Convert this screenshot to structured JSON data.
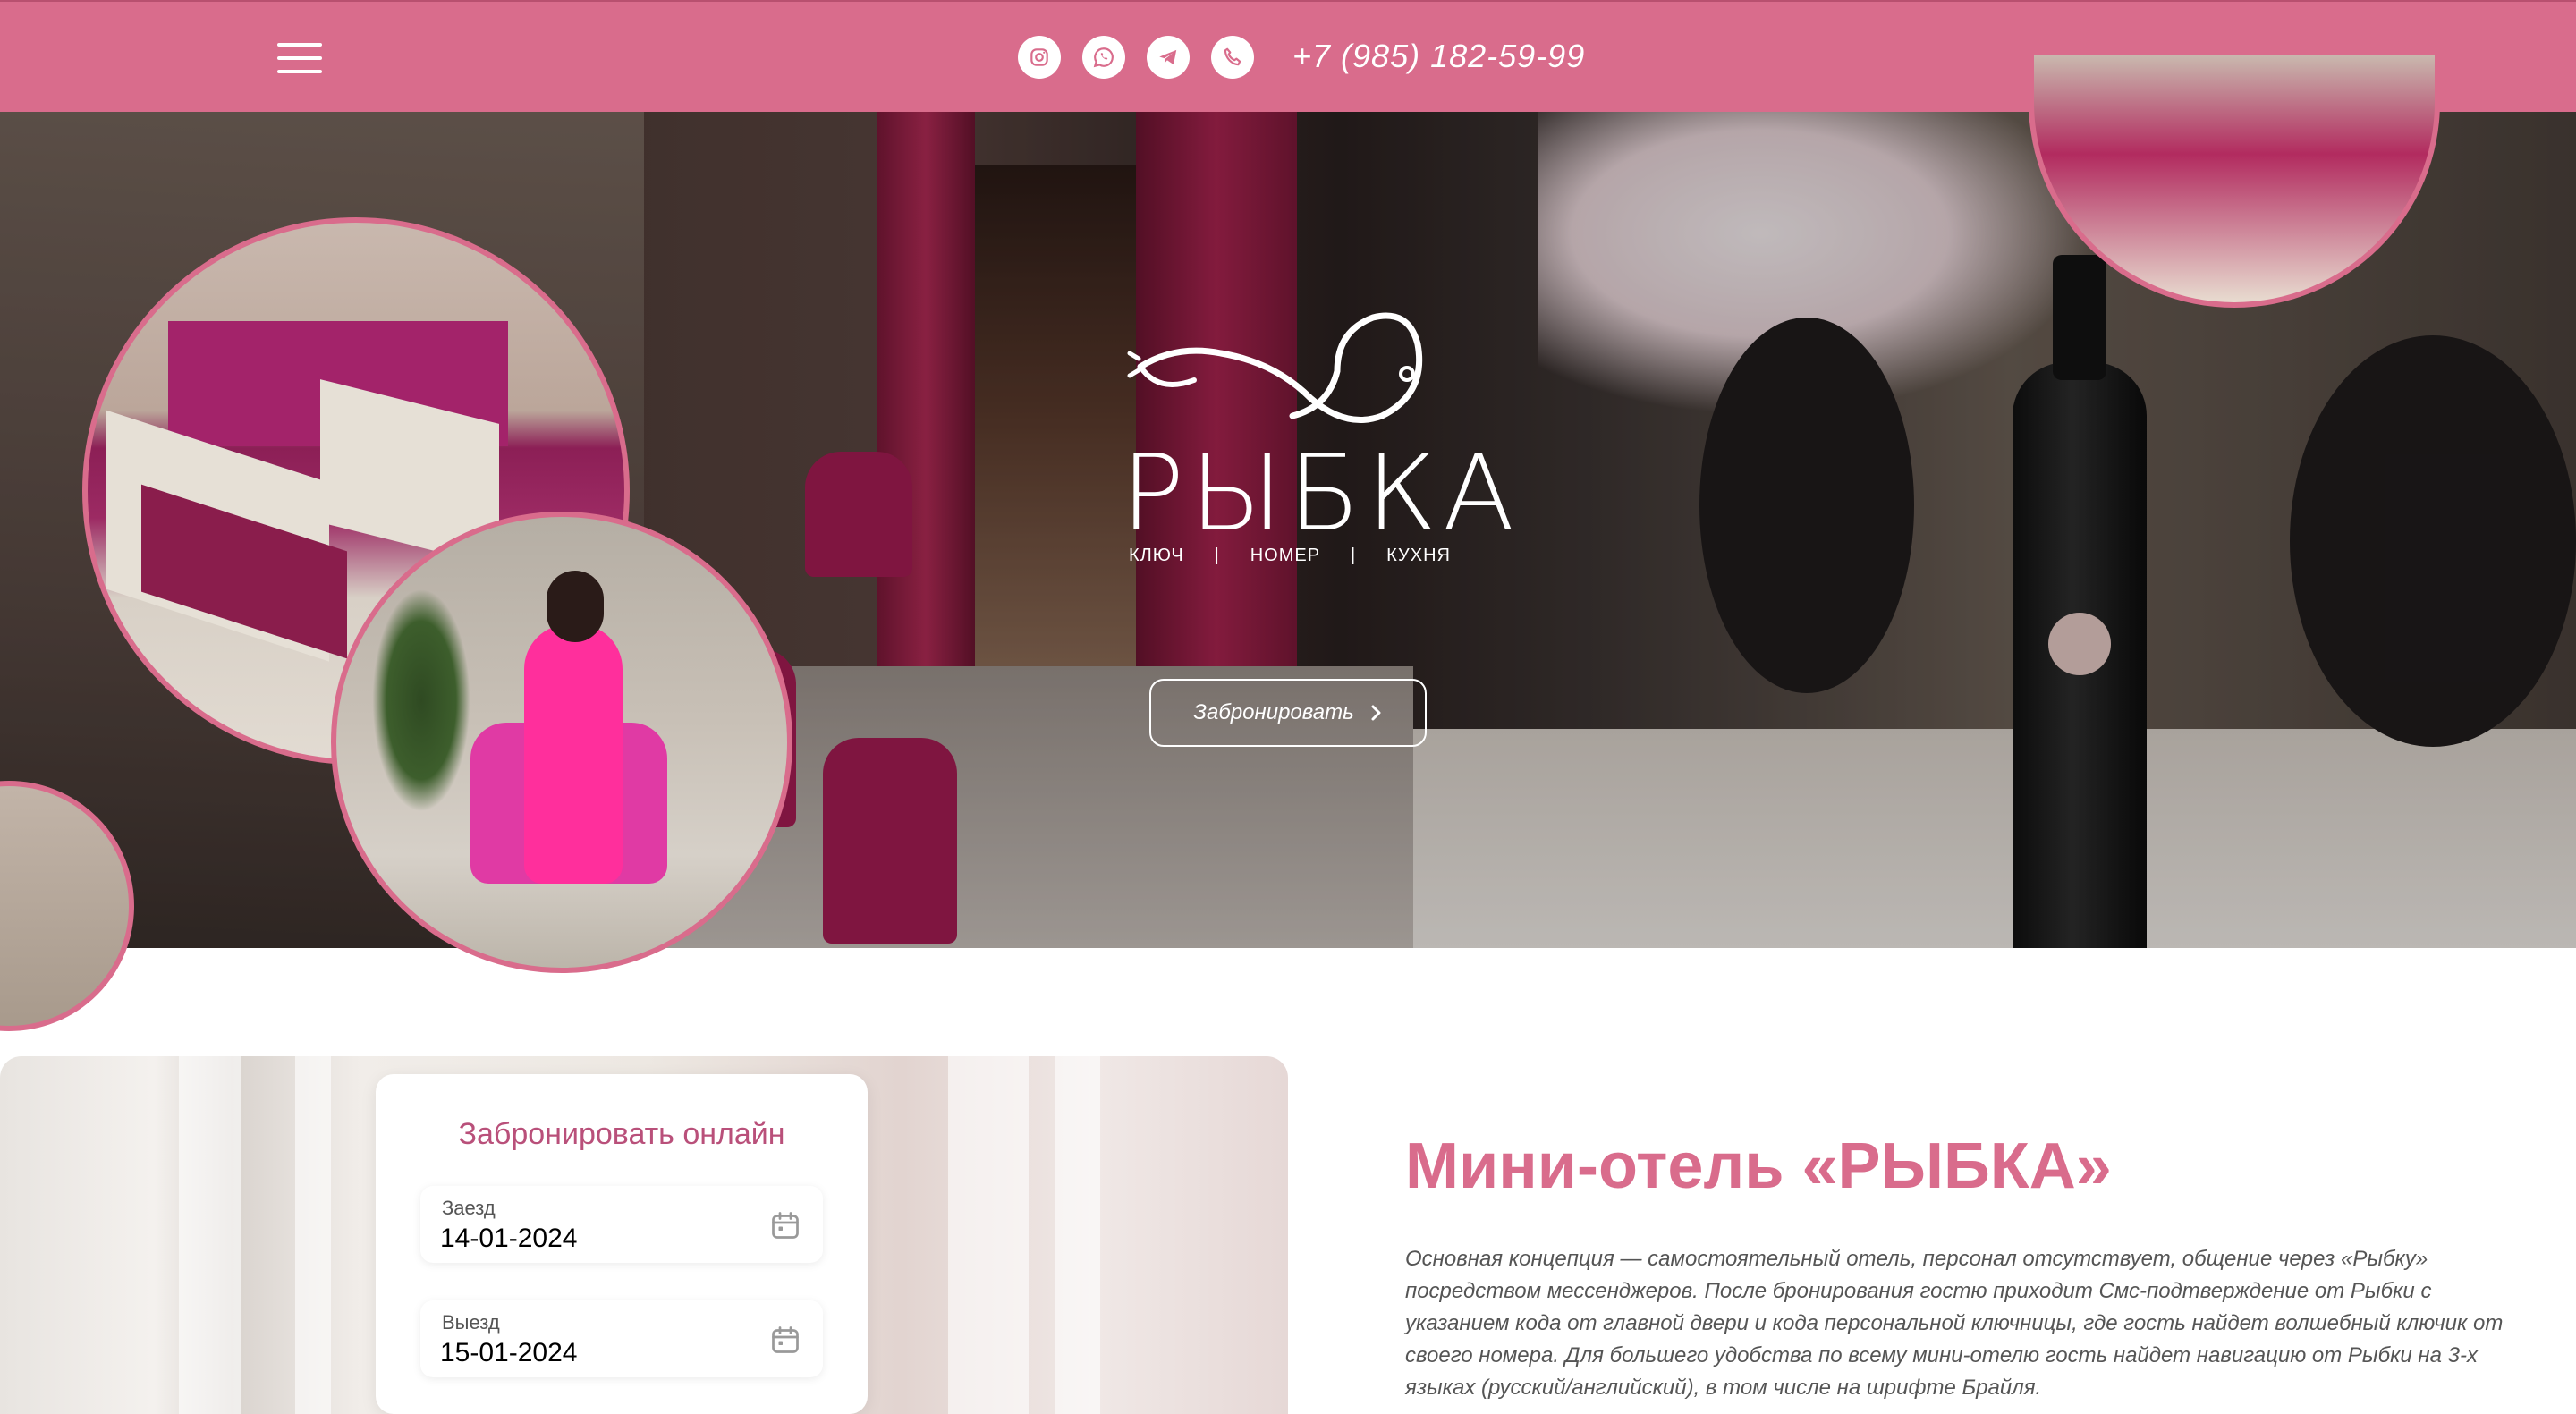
{
  "header": {
    "phone": "+7 (985) 182-59-99",
    "socials": [
      "instagram-icon",
      "whatsapp-icon",
      "telegram-icon",
      "phone-icon"
    ],
    "accent": "#d96c8c"
  },
  "hero": {
    "brand": "РЫБКА",
    "tagline": [
      "КЛЮЧ",
      "|",
      "НОМЕР",
      "|",
      "КУХНЯ"
    ],
    "book_button": "Забронировать"
  },
  "booking": {
    "title": "Забронировать онлайн",
    "checkin_label": "Заезд",
    "checkin_value": "14-01-2024",
    "checkout_label": "Выезд",
    "checkout_value": "15-01-2024"
  },
  "about": {
    "title": "Мини-отель «РЫБКА»",
    "text": "Основная концепция — самостоятельный отель, персонал отсутствует, общение через «Рыбку» посредством мессенджеров. После бронирования гостю приходит Смс-подтверждение от Рыбки с указанием кода от главной двери и кода персональной ключницы, где гость найдет волшебный ключик от своего номера. Для большего удобства по всему мини-отелю гость найдет навигацию от Рыбки на 3-х языках (русский/английский), в том числе на шрифте Брайля."
  }
}
